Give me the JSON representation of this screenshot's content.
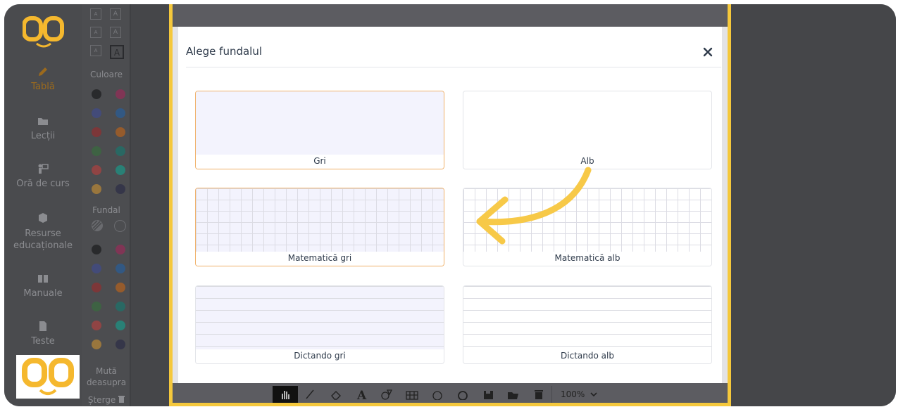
{
  "sidebar": {
    "items": [
      {
        "label": "Tablă",
        "icon": "pencil-icon",
        "active": true
      },
      {
        "label": "Lecții",
        "icon": "folder-icon"
      },
      {
        "label": "Oră de curs",
        "icon": "teacher-icon"
      },
      {
        "label": "Resurse educaționale",
        "icon": "box-icon"
      },
      {
        "label": "Manuale",
        "icon": "book-icon"
      },
      {
        "label": "Teste",
        "icon": "document-icon"
      }
    ]
  },
  "palette": {
    "color_title": "Culoare",
    "background_title": "Fundal",
    "font_sizes": [
      "A",
      "A",
      "A"
    ],
    "move_front": "Mută deasupra",
    "delete": "Șterge",
    "colors": [
      "#000000",
      "#c2185b",
      "#3949ab",
      "#1565c0",
      "#b71c1c",
      "#ef6c00",
      "#2e7d32",
      "#00897b",
      "#e53935",
      "#00bfa5",
      "#f9a825",
      "#1a1a40"
    ]
  },
  "toolbar": {
    "zoom": "100%",
    "tools": [
      "hand-icon",
      "pencil-icon",
      "eraser-icon",
      "text-icon",
      "shapes-icon",
      "table-icon",
      "circle-icon",
      "ring-icon",
      "save-icon",
      "open-folder-icon",
      "trash-icon"
    ]
  },
  "modal": {
    "title": "Alege fundalul",
    "close_icon": "close-icon",
    "options": [
      {
        "label": "Gri",
        "selected": true
      },
      {
        "label": "Alb"
      },
      {
        "label": "Matematică gri",
        "selected": true
      },
      {
        "label": "Matematică alb"
      },
      {
        "label": "Dictando gri"
      },
      {
        "label": "Dictando alb"
      }
    ]
  },
  "colors": {
    "accent": "#f5c83c",
    "arrow": "#f7c948",
    "logo": "#f5b82e",
    "selected_border": "#f0b068"
  }
}
